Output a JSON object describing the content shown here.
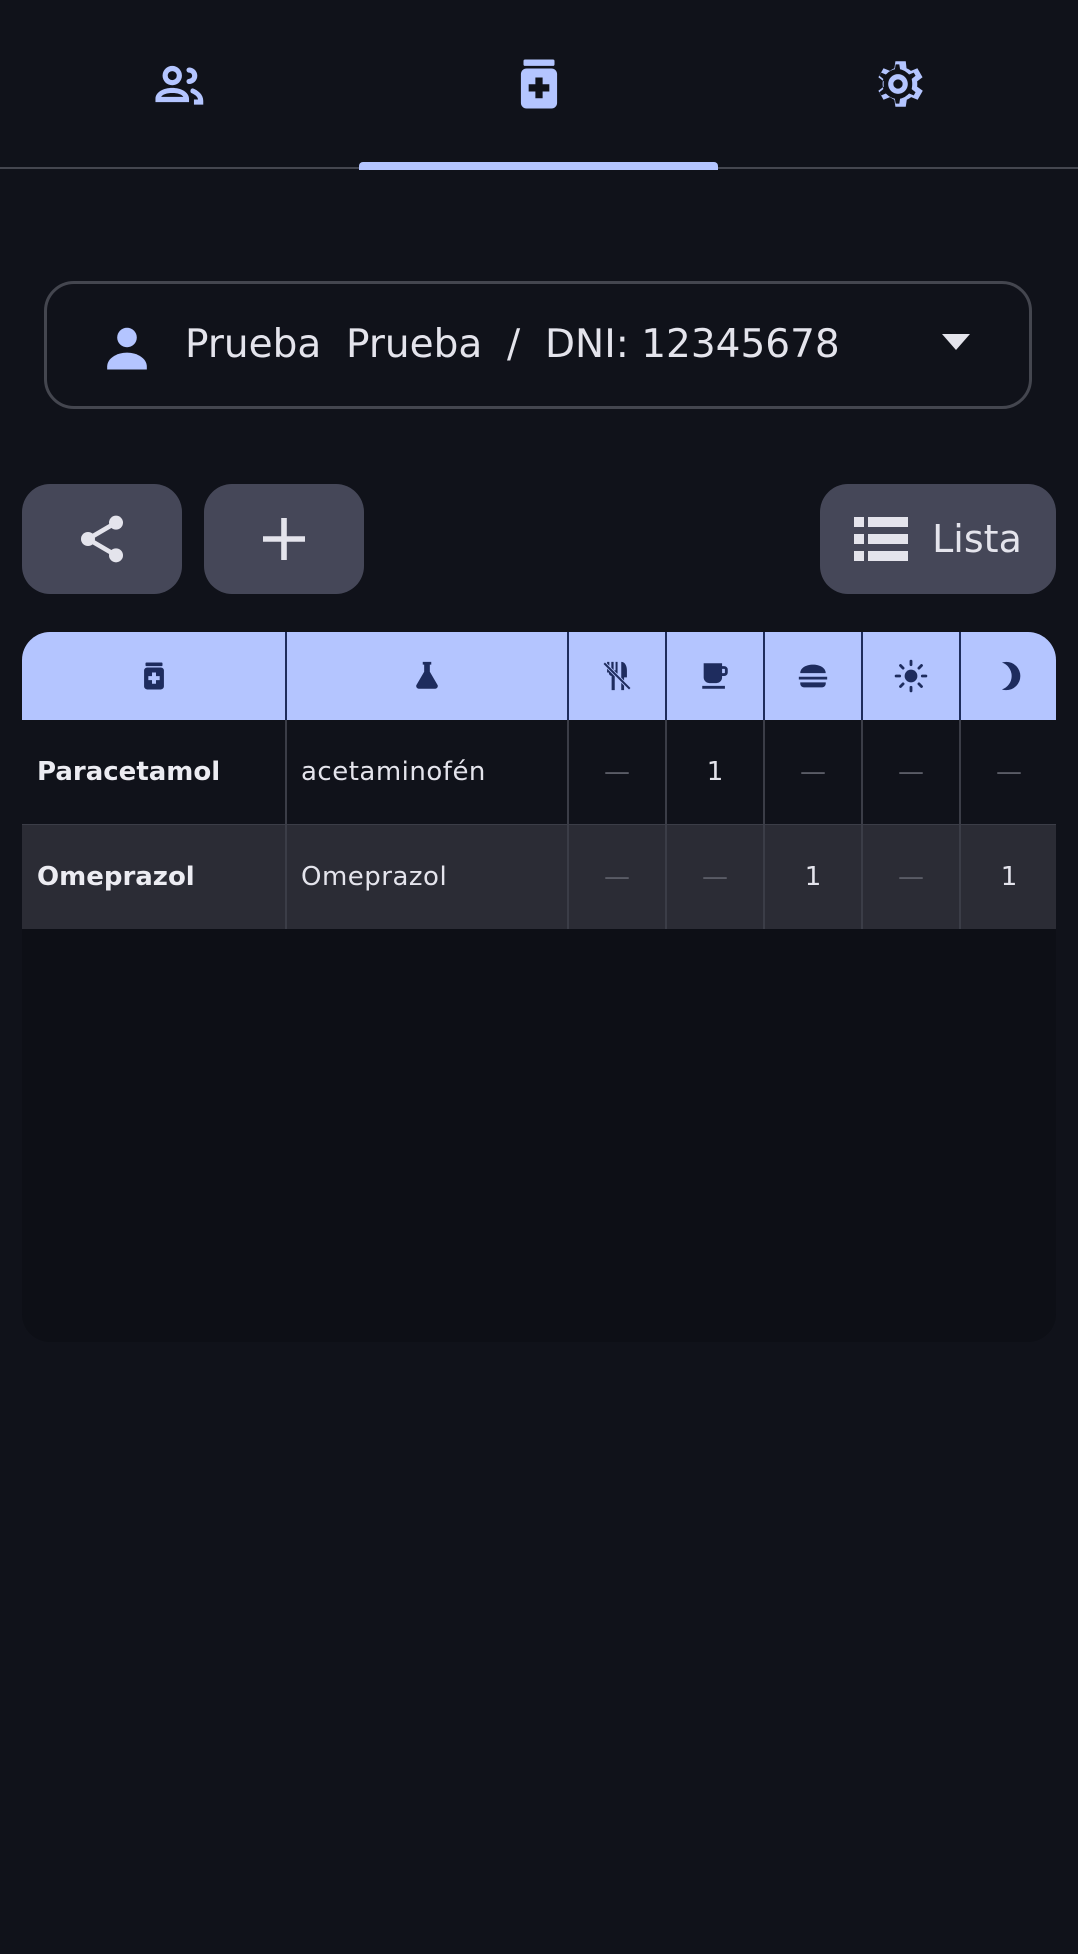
{
  "tabs": [
    {
      "icon": "people-icon",
      "selected": false
    },
    {
      "icon": "medication-icon",
      "selected": true
    },
    {
      "icon": "gear-icon",
      "selected": false
    }
  ],
  "patient": {
    "label": "Prueba  Prueba  /  DNI: 12345678"
  },
  "buttons": {
    "list_label": "Lista"
  },
  "table": {
    "columns": [
      {
        "icon": "medication-icon"
      },
      {
        "icon": "flask-icon"
      },
      {
        "icon": "fasting-icon"
      },
      {
        "icon": "coffee-icon"
      },
      {
        "icon": "burger-icon"
      },
      {
        "icon": "sun-icon"
      },
      {
        "icon": "moon-icon"
      }
    ],
    "rows": [
      {
        "name": "Paracetamol",
        "active": "acetaminofén",
        "doses": [
          "—",
          "1",
          "—",
          "—",
          "—"
        ]
      },
      {
        "name": "Omeprazol",
        "active": "Omeprazol",
        "doses": [
          "—",
          "—",
          "1",
          "—",
          "1"
        ]
      }
    ]
  },
  "colors": {
    "background": "#10121a",
    "accent": "#b4c5ff",
    "button": "#454758",
    "row_alt": "#2b2c35"
  }
}
